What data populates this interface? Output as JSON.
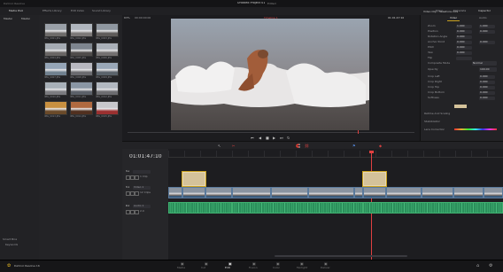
{
  "titlebar": {
    "app": "DaVinci Resolve",
    "project": "Untitled Project 01",
    "status": "Edited",
    "tabs_left": [
      "Media Pool",
      "Effects Library",
      "Edit Index",
      "Sound Library"
    ],
    "tabs_right": [
      "Mixer",
      "Metadata",
      "Inspector"
    ]
  },
  "media_pool": {
    "bin_header": "Master",
    "bins": [
      "Master"
    ],
    "smart_bins": "Smart Bins",
    "smart_bin_item": "Keywords",
    "clips": [
      "IMG_0001.JPG",
      "IMG_0002.JPG",
      "IMG_0003.JPG",
      "IMG_0004.JPG",
      "IMG_0005.JPG",
      "IMG_0006.JPG",
      "IMG_0007.JPG",
      "IMG_0008.JPG",
      "IMG_0009.JPG",
      "IMG_0010.JPG",
      "IMG_0011.JPG",
      "IMG_0012.JPG",
      "IMG_0013.JPG",
      "IMG_0014.JPG",
      "IMG_0015.JPG"
    ]
  },
  "viewer": {
    "zoom": "63%",
    "source_timecode": "00:00:00:00",
    "timeline_name": "Timeline 1",
    "record_timecode": "01:01:47:10"
  },
  "timeline": {
    "timecode": "01:01:47:10",
    "tracks": [
      {
        "id": "V2",
        "name": "",
        "clips": "1 Clip"
      },
      {
        "id": "V1",
        "name": "Video 1",
        "clips": "12 Clips"
      },
      {
        "id": "A1",
        "name": "Audio 1",
        "clips": "2.0"
      }
    ]
  },
  "inspector": {
    "title": "Video Clip - Seashore.mov",
    "tabs": [
      "Video",
      "Audio"
    ],
    "sections": [
      {
        "label": "Zoom",
        "x": "1.000",
        "y": "1.000"
      },
      {
        "label": "Position",
        "x": "0.000",
        "y": "0.000"
      },
      {
        "label": "Rotation Angle",
        "x": "0.000"
      },
      {
        "label": "Anchor Point",
        "x": "0.000",
        "y": "0.000"
      },
      {
        "label": "Pitch",
        "x": "0.000"
      },
      {
        "label": "Yaw",
        "x": "0.000"
      },
      {
        "label": "Flip",
        "x": ""
      }
    ],
    "composite_mode_label": "Composite Mode",
    "composite_mode": "Normal",
    "opacity_label": "Opacity",
    "opacity": "100.00",
    "crop_labels": [
      "Crop Left",
      "Crop Right",
      "Crop Top",
      "Crop Bottom",
      "Softness"
    ],
    "crop_values": [
      "0.000",
      "0.000",
      "0.000",
      "0.000",
      "0.000"
    ],
    "retime_label": "Retime And Scaling",
    "stabilization": "Stabilization",
    "lens": "Lens Correction",
    "color": "#d4c29a"
  },
  "pages": [
    "Media",
    "Cut",
    "Edit",
    "Fusion",
    "Color",
    "Fairlight",
    "Deliver"
  ],
  "active_page": "Edit",
  "footer_app": "DaVinci Resolve 16"
}
